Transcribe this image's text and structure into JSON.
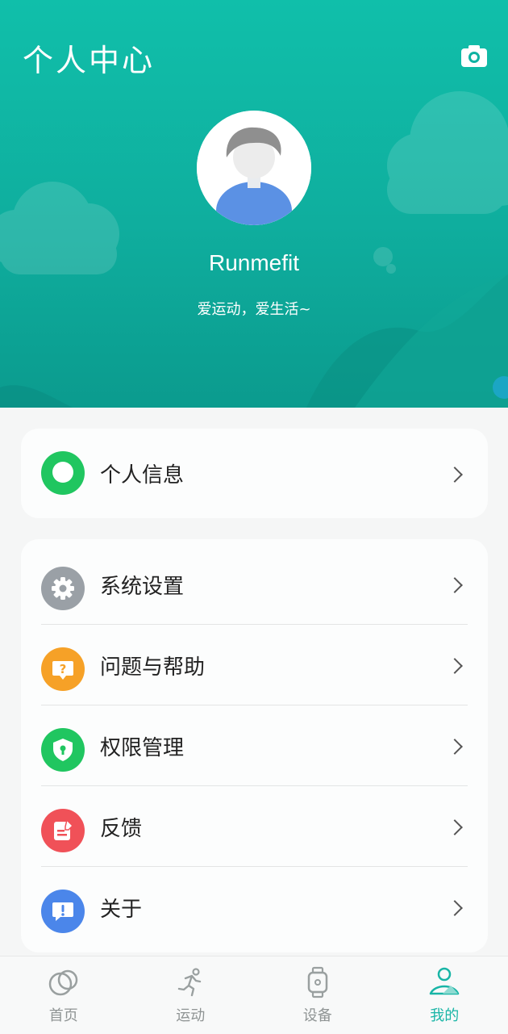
{
  "header": {
    "title": "个人中心",
    "camera_icon": "camera-icon",
    "avatar_icon": "default-avatar",
    "username": "Runmefit",
    "bio": "爱运动，爱生活~"
  },
  "menu_primary": [
    {
      "label": "个人信息",
      "icon": "profile-icon",
      "color": "#20c660"
    }
  ],
  "menu_secondary": [
    {
      "label": "系统设置",
      "icon": "gear-icon",
      "color": "#9aa0a6"
    },
    {
      "label": "问题与帮助",
      "icon": "question-icon",
      "color": "#f6a127"
    },
    {
      "label": "权限管理",
      "icon": "shield-lock-icon",
      "color": "#20c660"
    },
    {
      "label": "反馈",
      "icon": "feedback-edit-icon",
      "color": "#f05158"
    },
    {
      "label": "关于",
      "icon": "info-exclaim-icon",
      "color": "#4b86ea"
    }
  ],
  "nav": {
    "items": [
      {
        "label": "首页",
        "icon": "home-circles-icon",
        "active": false
      },
      {
        "label": "运动",
        "icon": "runner-icon",
        "active": false
      },
      {
        "label": "设备",
        "icon": "watch-icon",
        "active": false
      },
      {
        "label": "我的",
        "icon": "user-mountain-icon",
        "active": true
      }
    ],
    "active_color": "#18b5a6",
    "inactive_color": "#8f9494"
  },
  "colors": {
    "header_teal": "#10bfaa",
    "background": "#f5f6f6"
  }
}
